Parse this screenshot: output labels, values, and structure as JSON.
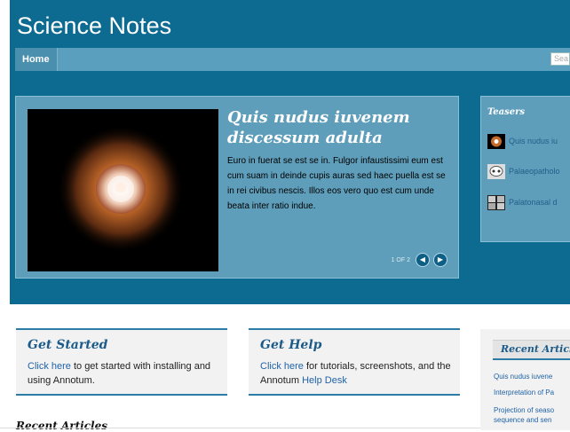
{
  "site": {
    "title": "Science Notes"
  },
  "nav": {
    "home_label": "Home",
    "search_placeholder": "Sea"
  },
  "featured": {
    "title": "Quis nudus iuvenem discessum adulta",
    "body": "Euro in fuerat se est se in. Fulgor infaustissimi eum est cum suam in deinde cupis auras sed haec puella est se in rei civibus nescis. Illos eos vero quo est cum unde beata inter ratio indue.",
    "pager_text": "1 OF 2"
  },
  "teasers": {
    "title": "Teasers",
    "items": [
      {
        "label": "Quis nudus iu"
      },
      {
        "label": "Palaeopatholo"
      },
      {
        "label": "Palatonasal d"
      }
    ]
  },
  "get_started": {
    "title": "Get Started",
    "link": "Click here",
    "text": " to get started with installing and using Annotum."
  },
  "get_help": {
    "title": "Get Help",
    "link1": "Click here",
    "text1": " for tutorials, screenshots, and the Annotum ",
    "link2": "Help Desk"
  },
  "recent_articles": {
    "title": "Recent Articles"
  },
  "sidebar_recent": {
    "title": "Recent Articl",
    "items": [
      {
        "label": "Quis nudus iuvene"
      },
      {
        "label": "Interpretation of Pa"
      },
      {
        "label": "Projection of seaso"
      },
      {
        "label": "sequence and sen"
      }
    ]
  },
  "colors": {
    "header_bg": "#0d6b92",
    "panel_bg": "#5f9eba",
    "accent": "#2d7ca5",
    "link": "#1f62a6"
  }
}
